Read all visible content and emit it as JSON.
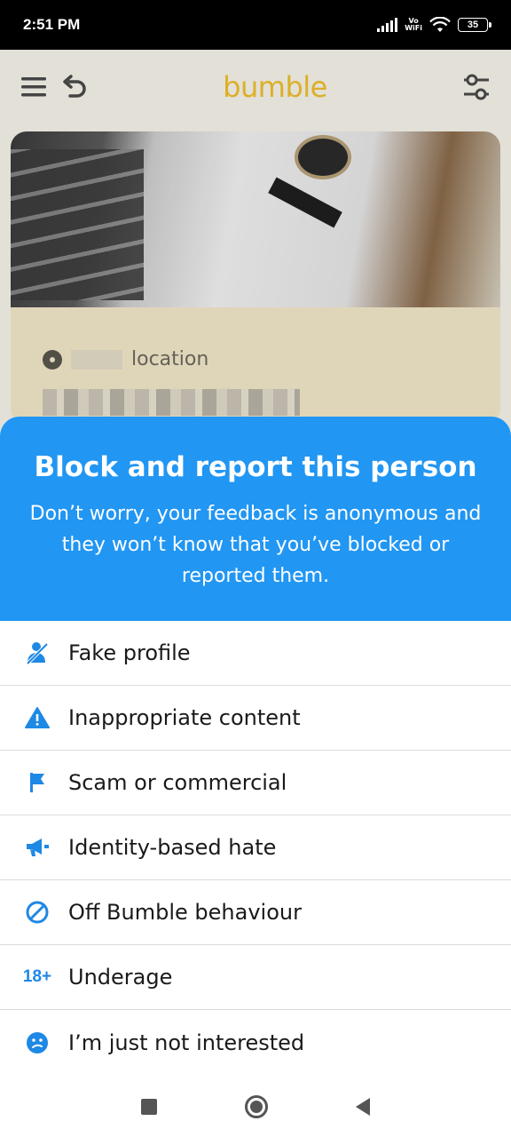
{
  "status_bar": {
    "time": "2:51 PM",
    "vowifi_top": "Vo",
    "vowifi_bottom": "WiFi",
    "battery": "35"
  },
  "app": {
    "logo": "bumble",
    "profile": {
      "location_label": "location"
    }
  },
  "sheet": {
    "title": "Block and report this person",
    "subtitle": "Don’t worry, your feedback is anonymous and they won’t know that you’ve blocked or reported them.",
    "options": [
      {
        "label": "Fake profile",
        "icon": "fake-profile-icon"
      },
      {
        "label": "Inappropriate content",
        "icon": "warning-icon"
      },
      {
        "label": "Scam or commercial",
        "icon": "flag-icon"
      },
      {
        "label": "Identity-based hate",
        "icon": "megaphone-icon"
      },
      {
        "label": "Off Bumble behaviour",
        "icon": "prohibited-icon"
      },
      {
        "label": "Underage",
        "icon": "age-18-icon",
        "icon_text": "18+"
      },
      {
        "label": "I’m just not interested",
        "icon": "face-icon"
      }
    ]
  },
  "colors": {
    "accent": "#2196f3",
    "brand_yellow": "#f0be2c",
    "icon_blue": "#1e88e5"
  }
}
